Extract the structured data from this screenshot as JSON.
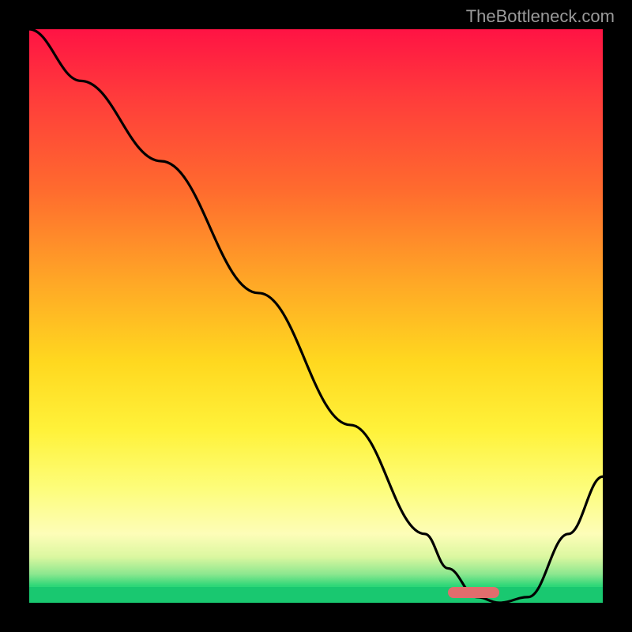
{
  "watermark": "TheBottleneck.com",
  "chart_data": {
    "type": "line",
    "title": "",
    "xlabel": "",
    "ylabel": "",
    "xlim": [
      0,
      100
    ],
    "ylim": [
      0,
      100
    ],
    "series": [
      {
        "name": "bottleneck-curve",
        "x": [
          0,
          9,
          23,
          40,
          56,
          69,
          73,
          78,
          82,
          87,
          94,
          100
        ],
        "values": [
          100,
          91,
          77,
          54,
          31,
          12,
          6,
          1,
          0,
          1,
          12,
          22
        ]
      }
    ],
    "marker": {
      "x_start": 73,
      "x_end": 82,
      "y": 0
    },
    "gradient": {
      "top": "#ff1344",
      "mid": "#ffd81f",
      "bottom": "#19c870"
    }
  }
}
